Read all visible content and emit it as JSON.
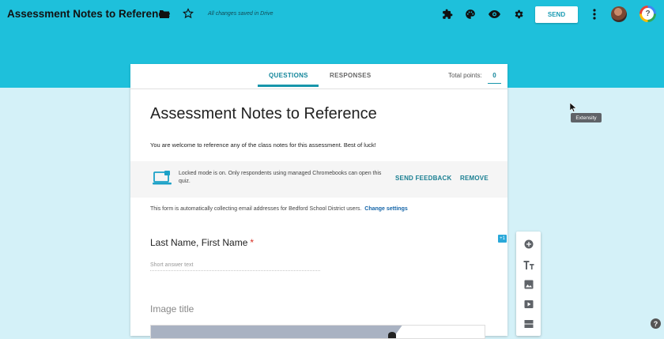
{
  "header": {
    "title": "Assessment Notes to Reference",
    "save_status": "All changes saved in Drive",
    "send_label": "SEND",
    "icons": [
      "folder-icon",
      "star-icon",
      "puzzle-icon",
      "palette-icon",
      "eye-icon",
      "gear-icon",
      "more-vert-icon"
    ],
    "account_glyph": "?"
  },
  "tabs": {
    "questions": "QUESTIONS",
    "responses": "RESPONSES",
    "total_points_label": "Total points:",
    "total_points_value": "0"
  },
  "form": {
    "title": "Assessment Notes to Reference",
    "description": "You are welcome to reference any of the class notes for this assessment. Best of luck!"
  },
  "locked_mode": {
    "text": "Locked mode is on. Only respondents using managed Chromebooks can open this quiz.",
    "send_feedback": "SEND FEEDBACK",
    "remove": "REMOVE"
  },
  "email_notice": {
    "text": "This form is automatically collecting email addresses for Bedford School District users.",
    "link": "Change settings"
  },
  "questions": [
    {
      "title": "Last Name, First Name",
      "required_mark": "*",
      "placeholder": "Short answer text"
    }
  ],
  "image_item": {
    "title": "Image title"
  },
  "side_toolbar": {
    "add_badge": "+1",
    "icons": [
      "add-question-icon",
      "add-title-icon",
      "add-image-icon",
      "add-video-icon",
      "add-section-icon"
    ]
  },
  "tooltip": "Extensity",
  "help_glyph": "?",
  "colors": {
    "accent": "#1ec0db",
    "page_bg": "#d4f1f8",
    "link": "#1565a8",
    "required": "#d93025"
  }
}
